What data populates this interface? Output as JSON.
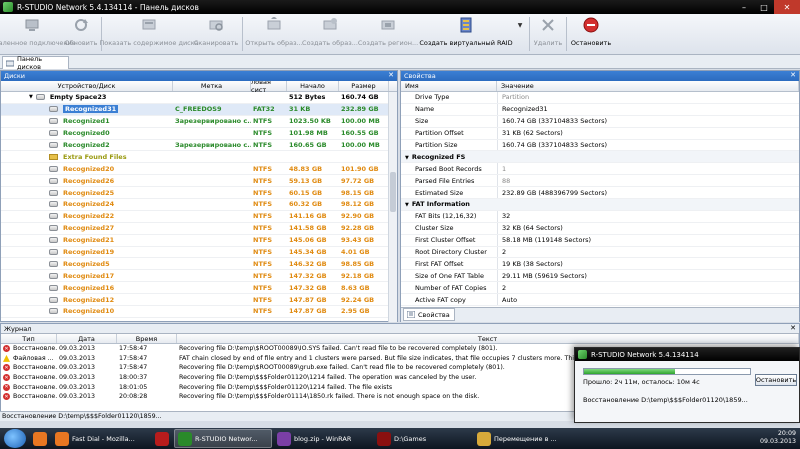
{
  "window": {
    "title": "R-STUDIO Network 5.4.134114 - Панель дисков"
  },
  "toolbar": {
    "buttons": [
      {
        "label": "Удаленное подключение",
        "icon": "remote-connect-icon"
      },
      {
        "label": "Обновить",
        "icon": "refresh-icon"
      },
      {
        "label": "Показать содержимое диска",
        "icon": "show-contents-icon"
      },
      {
        "label": "Сканировать",
        "icon": "scan-icon"
      },
      {
        "label": "Открыть образ...",
        "icon": "open-image-icon"
      },
      {
        "label": "Создать образ...",
        "icon": "create-image-icon"
      },
      {
        "label": "Создать регион...",
        "icon": "create-region-icon"
      },
      {
        "label": "Создать виртуальный RAID",
        "icon": "virtual-raid-icon"
      },
      {
        "label": "Удалить",
        "icon": "delete-icon"
      },
      {
        "label": "Остановить",
        "icon": "stop-icon"
      }
    ]
  },
  "tab": {
    "label": "Панель дисков"
  },
  "disks_panel": {
    "title": "Диски",
    "columns": [
      "Устройство/Диск",
      "Метка",
      "ловая сист",
      "Начало",
      "Размер"
    ],
    "rows": [
      {
        "name": "Empty Space23",
        "label": "",
        "fs": "",
        "start": "512 Bytes",
        "size": "160.74 GB",
        "color": "black",
        "kind": "root"
      },
      {
        "name": "Recognized31",
        "label": "C_FREEDOS9",
        "fs": "FAT32",
        "start": "31 KB",
        "size": "232.89 GB",
        "color": "green",
        "kind": "hdd",
        "selected": true
      },
      {
        "name": "Recognized1",
        "label": "Зарезервировано с...",
        "fs": "NTFS",
        "start": "1023.50 KB",
        "size": "100.00 MB",
        "color": "green",
        "kind": "hdd"
      },
      {
        "name": "Recognized0",
        "label": "",
        "fs": "NTFS",
        "start": "101.98 MB",
        "size": "160.55 GB",
        "color": "green",
        "kind": "hdd"
      },
      {
        "name": "Recognized2",
        "label": "Зарезервировано с...",
        "fs": "NTFS",
        "start": "160.65 GB",
        "size": "100.00 MB",
        "color": "green",
        "kind": "hdd"
      },
      {
        "name": "Extra Found Files",
        "label": "",
        "fs": "",
        "start": "",
        "size": "",
        "color": "olive",
        "kind": "folder"
      },
      {
        "name": "Recognized20",
        "label": "",
        "fs": "NTFS",
        "start": "48.83 GB",
        "size": "101.90 GB",
        "color": "orange",
        "kind": "hdd"
      },
      {
        "name": "Recognized26",
        "label": "",
        "fs": "NTFS",
        "start": "59.13 GB",
        "size": "97.72 GB",
        "color": "orange",
        "kind": "hdd"
      },
      {
        "name": "Recognized25",
        "label": "",
        "fs": "NTFS",
        "start": "60.15 GB",
        "size": "98.15 GB",
        "color": "orange",
        "kind": "hdd"
      },
      {
        "name": "Recognized24",
        "label": "",
        "fs": "NTFS",
        "start": "60.32 GB",
        "size": "98.12 GB",
        "color": "orange",
        "kind": "hdd"
      },
      {
        "name": "Recognized22",
        "label": "",
        "fs": "NTFS",
        "start": "141.16 GB",
        "size": "92.90 GB",
        "color": "orange",
        "kind": "hdd"
      },
      {
        "name": "Recognized27",
        "label": "",
        "fs": "NTFS",
        "start": "141.58 GB",
        "size": "92.28 GB",
        "color": "orange",
        "kind": "hdd"
      },
      {
        "name": "Recognized21",
        "label": "",
        "fs": "NTFS",
        "start": "145.06 GB",
        "size": "93.43 GB",
        "color": "orange",
        "kind": "hdd"
      },
      {
        "name": "Recognized19",
        "label": "",
        "fs": "NTFS",
        "start": "145.34 GB",
        "size": "4.01 GB",
        "color": "orange",
        "kind": "hdd"
      },
      {
        "name": "Recognized5",
        "label": "",
        "fs": "NTFS",
        "start": "146.32 GB",
        "size": "98.85 GB",
        "color": "orange",
        "kind": "hdd"
      },
      {
        "name": "Recognized17",
        "label": "",
        "fs": "NTFS",
        "start": "147.32 GB",
        "size": "92.18 GB",
        "color": "orange",
        "kind": "hdd"
      },
      {
        "name": "Recognized16",
        "label": "",
        "fs": "NTFS",
        "start": "147.32 GB",
        "size": "8.63 GB",
        "color": "orange",
        "kind": "hdd"
      },
      {
        "name": "Recognized12",
        "label": "",
        "fs": "NTFS",
        "start": "147.87 GB",
        "size": "92.24 GB",
        "color": "orange",
        "kind": "hdd"
      },
      {
        "name": "Recognized10",
        "label": "",
        "fs": "NTFS",
        "start": "147.87 GB",
        "size": "2.95 GB",
        "color": "orange",
        "kind": "hdd"
      }
    ]
  },
  "properties_panel": {
    "title": "Свойства",
    "columns": [
      "Имя",
      "Значение"
    ],
    "rows": [
      {
        "name": "Drive Type",
        "value": "Partition",
        "gray": true
      },
      {
        "name": "Name",
        "value": "Recognized31"
      },
      {
        "name": "Size",
        "value": "160.74 GB (337104833 Sectors)"
      },
      {
        "name": "Partition Offset",
        "value": "31 KB (62 Sectors)"
      },
      {
        "name": "Partition Size",
        "value": "160.74 GB (337104833 Sectors)"
      },
      {
        "name": "Recognized FS",
        "value": "",
        "group": true
      },
      {
        "name": "Parsed Boot Records",
        "value": "1",
        "gray": true
      },
      {
        "name": "Parsed File Entries",
        "value": "88",
        "gray": true
      },
      {
        "name": "Estimated Size",
        "value": "232.89 GB (488396799 Sectors)"
      },
      {
        "name": "FAT Information",
        "value": "",
        "group": true
      },
      {
        "name": "FAT Bits (12,16,32)",
        "value": "32"
      },
      {
        "name": "Cluster Size",
        "value": "32 KB (64 Sectors)"
      },
      {
        "name": "First Cluster Offset",
        "value": "58.18 MB (119148 Sectors)"
      },
      {
        "name": "Root Directory Cluster",
        "value": "2"
      },
      {
        "name": "First FAT Offset",
        "value": "19 KB (38 Sectors)"
      },
      {
        "name": "Size of One FAT Table",
        "value": "29.11 MB (59619 Sectors)"
      },
      {
        "name": "Number of FAT Copies",
        "value": "2"
      },
      {
        "name": "Active FAT copy",
        "value": "Auto"
      }
    ],
    "tab_label": "Свойства"
  },
  "log_panel": {
    "title": "Журнал",
    "columns": [
      "Тип",
      "Дата",
      "Время",
      "Текст"
    ],
    "rows": [
      {
        "type": "Восстановле...",
        "date": "09.03.2013",
        "time": "17:58:47",
        "text": "Recovering file D:\\temp\\$ROOT00089\\IO.SYS failed. Can't read file to be recovered completely (801).",
        "icon": "error"
      },
      {
        "type": "Файловая ...",
        "date": "09.03.2013",
        "time": "17:58:47",
        "text": "FAT chain closed by end of file entry and 1 clusters were parsed. But file size indicates, that file occupies 7 clusters more.  This may cause a ...",
        "icon": "warning"
      },
      {
        "type": "Восстановле...",
        "date": "09.03.2013",
        "time": "17:58:47",
        "text": "Recovering file D:\\temp\\$ROOT00089\\grub.exe failed. Can't read file to be recovered completely (801).",
        "icon": "error"
      },
      {
        "type": "Восстановле...",
        "date": "09.03.2013",
        "time": "18:00:37",
        "text": "Recovering file D:\\temp\\$$$Folder01120\\1214 failed. The operation was canceled by the user.",
        "icon": "error"
      },
      {
        "type": "Восстановле...",
        "date": "09.03.2013",
        "time": "18:01:05",
        "text": "Recovering file D:\\temp\\$$$Folder01120\\1214 failed. The file exists",
        "icon": "error"
      },
      {
        "type": "Восстановле...",
        "date": "09.03.2013",
        "time": "20:08:28",
        "text": "Recovering file D:\\temp\\$$$Folder01114\\1850.rk failed. There is not enough space on the disk.",
        "icon": "error"
      }
    ]
  },
  "statusbar": {
    "text": "Восстановление D:\\temp\\$$$Folder01120\\1859..."
  },
  "popup": {
    "title": "R-STUDIO Network 5.4.134114",
    "progress": 0.55,
    "progress_text": "Прошло: 2ч 11м, осталось: 10м 4с",
    "stop_label": "Остановить",
    "recovery_text": "Восстановление D:\\temp\\$$$Folder01120\\1859..."
  },
  "taskbar": {
    "apps": [
      {
        "label": "",
        "icon": "firefox-icon",
        "color": "#e87722"
      },
      {
        "label": "Fast Dial - Mozilla...",
        "icon": "firefox-window-icon",
        "color": "#e87722"
      },
      {
        "label": "",
        "icon": "filezilla-icon",
        "color": "#b71c1c"
      },
      {
        "label": "R-STUDIO Networ...",
        "icon": "rstudio-icon",
        "color": "#2a8a2a",
        "active": true
      },
      {
        "label": "blog.zip - WinRAR",
        "icon": "winrar-icon",
        "color": "#7b3fa6"
      },
      {
        "label": "D:\\Games",
        "icon": "folder-icon",
        "color": "#8a1010"
      },
      {
        "label": "Перемещение в ...",
        "icon": "explorer-icon",
        "color": "#d7a93a"
      }
    ],
    "clock_time": "20:09",
    "clock_date": "09.03.2013"
  }
}
